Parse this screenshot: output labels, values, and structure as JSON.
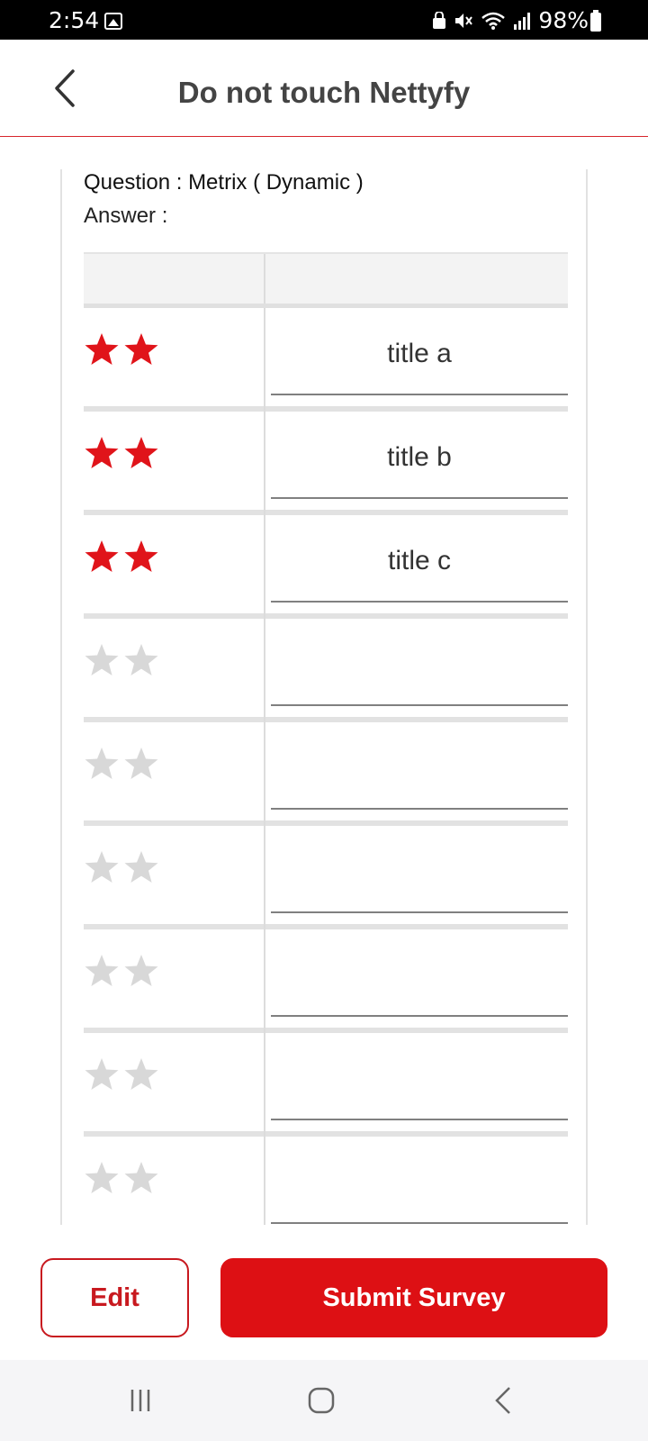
{
  "status_bar": {
    "time": "2:54",
    "battery": "98%",
    "icons": [
      "gallery-icon",
      "lock-icon",
      "mute-icon",
      "wifi-icon",
      "signal-icon",
      "battery-icon"
    ]
  },
  "header": {
    "title": "Do not touch Nettyfy",
    "back_icon": "chevron-left-icon"
  },
  "question": {
    "question_label": "Question : Metrix ( Dynamic )",
    "answer_label": "Answer :"
  },
  "matrix": {
    "rows": [
      {
        "rating": 2,
        "title": "title a"
      },
      {
        "rating": 2,
        "title": "title b"
      },
      {
        "rating": 2,
        "title": "title c"
      },
      {
        "rating": 0,
        "title": ""
      },
      {
        "rating": 0,
        "title": ""
      },
      {
        "rating": 0,
        "title": ""
      },
      {
        "rating": 0,
        "title": ""
      },
      {
        "rating": 0,
        "title": ""
      },
      {
        "rating": 0,
        "title": ""
      }
    ],
    "star_count": 2,
    "colors": {
      "active_star": "#e0141a",
      "inactive_star": "#d8d8d8"
    }
  },
  "footer": {
    "edit_label": "Edit",
    "submit_label": "Submit Survey"
  },
  "colors": {
    "brand_red": "#dd1014",
    "outline_red": "#c8191f"
  },
  "nav": {
    "items": [
      "recents-icon",
      "home-icon",
      "back-icon"
    ]
  }
}
